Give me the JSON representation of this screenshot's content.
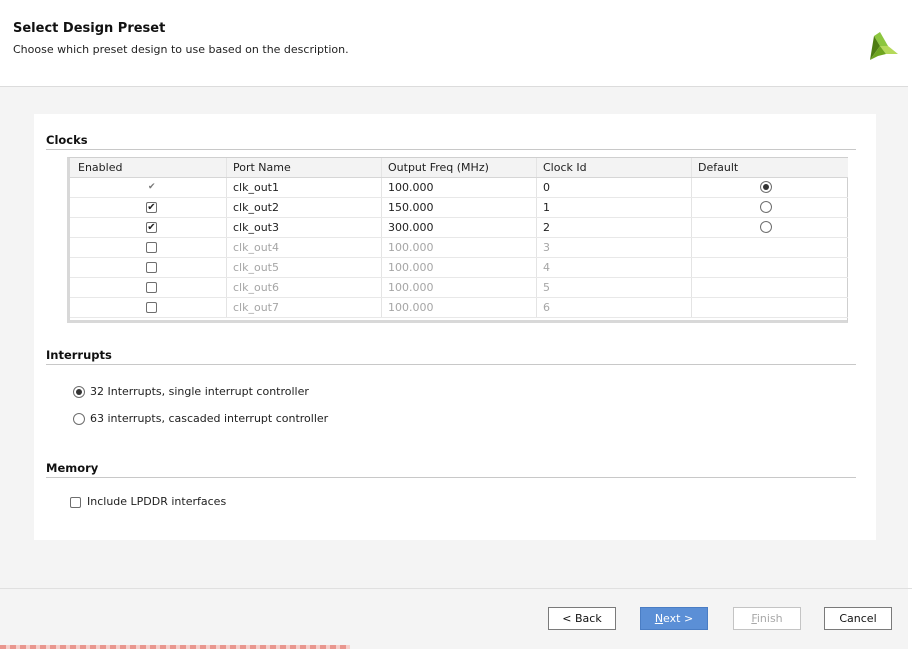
{
  "header": {
    "title": "Select Design Preset",
    "subtitle": "Choose which preset design to use based on the description."
  },
  "clocks": {
    "section_title": "Clocks",
    "columns": [
      "Enabled",
      "Port Name",
      "Output Freq (MHz)",
      "Clock Id",
      "Default"
    ],
    "rows": [
      {
        "enabled": "locked",
        "port": "clk_out1",
        "freq": "100.000",
        "id": "0",
        "default": "selected",
        "active": true
      },
      {
        "enabled": "checked",
        "port": "clk_out2",
        "freq": "150.000",
        "id": "1",
        "default": "unselected",
        "active": true
      },
      {
        "enabled": "checked",
        "port": "clk_out3",
        "freq": "300.000",
        "id": "2",
        "default": "unselected",
        "active": true
      },
      {
        "enabled": "unchecked",
        "port": "clk_out4",
        "freq": "100.000",
        "id": "3",
        "default": "none",
        "active": false
      },
      {
        "enabled": "unchecked",
        "port": "clk_out5",
        "freq": "100.000",
        "id": "4",
        "default": "none",
        "active": false
      },
      {
        "enabled": "unchecked",
        "port": "clk_out6",
        "freq": "100.000",
        "id": "5",
        "default": "none",
        "active": false
      },
      {
        "enabled": "unchecked",
        "port": "clk_out7",
        "freq": "100.000",
        "id": "6",
        "default": "none",
        "active": false
      }
    ]
  },
  "interrupts": {
    "section_title": "Interrupts",
    "options": [
      {
        "label": "32 Interrupts, single interrupt controller",
        "selected": true
      },
      {
        "label": "63 interrupts, cascaded interrupt controller",
        "selected": false
      }
    ]
  },
  "memory": {
    "section_title": "Memory",
    "include_lpddr_label": "Include LPDDR interfaces",
    "include_lpddr_checked": false
  },
  "footer": {
    "back_label": "< Back",
    "next_label": "Next >",
    "finish_label": "Finish",
    "cancel_label": "Cancel"
  },
  "colors": {
    "accent": "#5b8fd6",
    "logo_green": "#7ab317",
    "logo_dark": "#4b6b1a"
  },
  "icons": [
    "logo-icon",
    "checkmark-icon",
    "radio-icon",
    "checkbox-icon"
  ]
}
